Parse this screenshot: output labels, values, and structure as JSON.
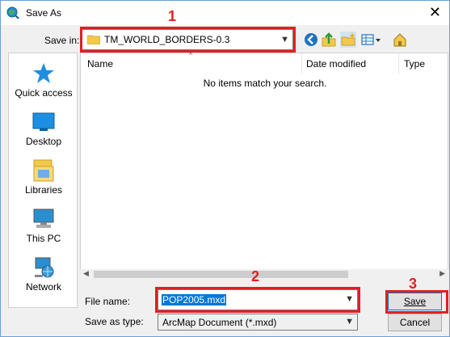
{
  "window": {
    "title": "Save As",
    "close_glyph": "✕"
  },
  "toolbar": {
    "save_in_label": "Save in:",
    "save_in_value": "TM_WORLD_BORDERS-0.3",
    "icons": [
      "back-icon",
      "up-folder-icon",
      "new-folder-icon",
      "view-menu-icon",
      "home-icon"
    ]
  },
  "places": [
    {
      "label": "Quick access",
      "icon": "star-icon"
    },
    {
      "label": "Desktop",
      "icon": "desktop-icon"
    },
    {
      "label": "Libraries",
      "icon": "libraries-icon"
    },
    {
      "label": "This PC",
      "icon": "computer-icon"
    },
    {
      "label": "Network",
      "icon": "network-icon"
    }
  ],
  "list": {
    "columns": [
      "Name",
      "Date modified",
      "Type"
    ],
    "empty_message": "No items match your search."
  },
  "form": {
    "file_name_label": "File name:",
    "file_name_value": "POP2005.mxd",
    "save_as_type_label": "Save as type:",
    "save_as_type_value": "ArcMap Document (*.mxd)",
    "save_label": "Save",
    "cancel_label": "Cancel"
  },
  "annotations": {
    "n1": "1",
    "n2": "2",
    "n3": "3"
  },
  "colors": {
    "annotation": "#e02020",
    "selection": "#0078d7",
    "window_border": "#6b9fd6"
  }
}
